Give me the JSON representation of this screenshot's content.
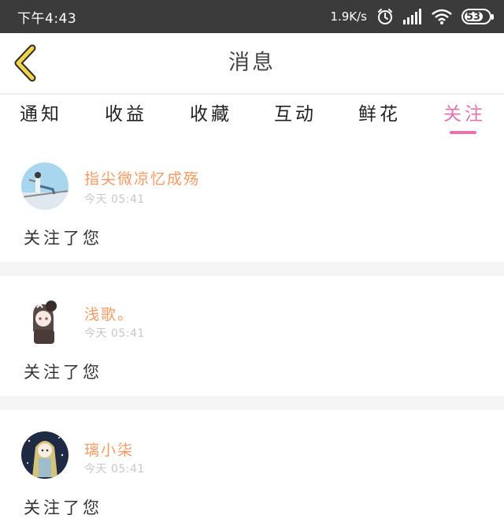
{
  "status_bar": {
    "time": "下午4:43",
    "speed": "1.9K/s",
    "battery": "53",
    "icons": [
      "alarm-icon",
      "signal-icon",
      "wifi-icon",
      "battery-icon"
    ]
  },
  "header": {
    "title": "消息",
    "back_icon": "chevron-left-icon"
  },
  "tabs": [
    {
      "label": "通知"
    },
    {
      "label": "收益"
    },
    {
      "label": "收藏"
    },
    {
      "label": "互动"
    },
    {
      "label": "鲜花"
    },
    {
      "label": "关注"
    }
  ],
  "active_tab": "关注",
  "colors": {
    "accent": "#e373ad",
    "username": "#f39a63",
    "back_icon": "#f3d34a",
    "status_bar": "#3b3b3b"
  },
  "notifications": [
    {
      "username": "指尖微凉忆成殇",
      "time": "今天 05:41",
      "message": "关注了您"
    },
    {
      "username": "浅歌。",
      "time": "今天 05:41",
      "message": "关注了您"
    },
    {
      "username": "璃小柒",
      "time": "今天 05:41",
      "message": "关注了您"
    }
  ]
}
